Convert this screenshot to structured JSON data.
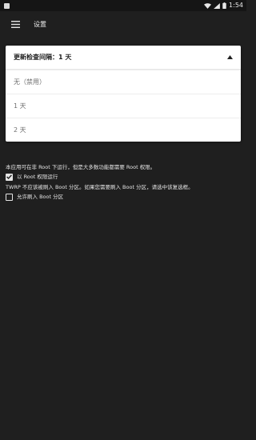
{
  "status_bar": {
    "time": "1:54",
    "icons": [
      "app-icon",
      "wifi-icon",
      "signal-icon",
      "battery-icon"
    ]
  },
  "toolbar": {
    "menu_icon": "hamburger-menu-icon",
    "title": "设置"
  },
  "update_dropdown": {
    "label": "更新检查间隔：1 天",
    "expand_icon": "triangle-up-icon",
    "options": [
      "无（禁用）",
      "1 天",
      "2 天"
    ]
  },
  "root_settings": {
    "root_notice": "本应用可在非 Root 下运行，但是大多数功能都需要 Root 权限。",
    "run_as_root_label": "以 Root 权限运行",
    "run_as_root_checked": true,
    "twrp_notice": "TWRP 不应该被刷入 Boot 分区。如果您需要刷入 Boot 分区，请选中该复选框。",
    "allow_boot_label": "允许刷入 Boot 分区",
    "allow_boot_checked": false
  },
  "colors": {
    "background": "#1f1f1f",
    "surface": "#ffffff",
    "text_primary": "#e6e6e6",
    "option_text": "#707070"
  }
}
